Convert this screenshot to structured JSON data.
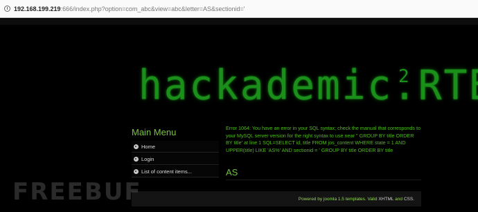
{
  "browser": {
    "url_host": "192.168.199.219",
    "url_path": ":666/index.php?option=com_abc&view=abc&letter=AS&sectionid='"
  },
  "site": {
    "logo_text": "hackademic.RTB",
    "logo_superscript": "2"
  },
  "menu": {
    "title": "Main Menu",
    "items": [
      {
        "label": "Home"
      },
      {
        "label": "Login"
      },
      {
        "label": "List of content items..."
      }
    ]
  },
  "content": {
    "error_message": "Error 1064: You have an error in your SQL syntax; check the manual that corresponds to your MySQL server version for the right syntax to use near '' GROUP BY title ORDER BY title' at line 1 SQL=SELECT id, title FROM jos_content WHERE state = 1 AND UPPER(title) LIKE 'AS%' AND sectionid = ' GROUP BY title ORDER BY title",
    "article_title": "AS"
  },
  "footer": {
    "powered_by": "Powered by",
    "joomla_link": "joomla 1.5 templates",
    "valid": "Valid",
    "xhtml": "XHTML",
    "and": "and",
    "css": "CSS."
  },
  "watermark": {
    "text": "FREEBUF"
  }
}
